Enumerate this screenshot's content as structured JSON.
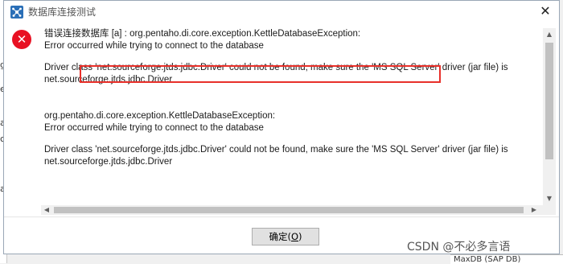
{
  "window": {
    "title": "数据库连接测试",
    "close_glyph": "✕",
    "app_icon": "app-network-icon"
  },
  "dialog": {
    "error_icon": "error-icon",
    "error_glyph": "✕",
    "messages": {
      "line1": "错误连接数据库 [a] : org.pentaho.di.core.exception.KettleDatabaseException:",
      "line2": "Error occurred while trying to connect to the database",
      "line3": "Driver class 'net.sourceforge.jtds.jdbc.Driver' could not be found, make sure the 'MS SQL Server' driver (jar file) is",
      "line4": "net.sourceforge.jtds.jdbc.Driver",
      "line5": "org.pentaho.di.core.exception.KettleDatabaseException:",
      "line6": "Error occurred while trying to connect to the database",
      "line7": "Driver class 'net.sourceforge.jtds.jdbc.Driver' could not be found, make sure the 'MS SQL Server' driver (jar file) is",
      "line8": "net.sourceforge.jtds.jdbc.Driver"
    },
    "ok_button_pre": "确定(",
    "ok_button_key": "O",
    "ok_button_post": ")"
  },
  "background": {
    "side_fragments": [
      "g",
      "e",
      "ar",
      "c",
      "ar"
    ],
    "bottom_fragment": "MaxDB (SAP DB)"
  },
  "watermark": "CSDN @不必多言语",
  "colors": {
    "highlight": "#e8302a",
    "error": "#e81123"
  }
}
